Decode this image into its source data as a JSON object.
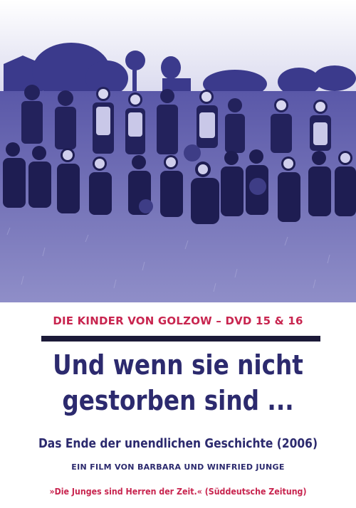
{
  "cover": {
    "series_line": "DIE KINDER VON GOLZOW – DVD 15 & 16",
    "title_line1": "Und wenn sie nicht",
    "title_line2": "gestorben sind ...",
    "subtitle": "Das Ende der unendlichen Geschichte (2006)",
    "credit": "EIN FILM VON BARBARA UND WINFRIED JUNGE",
    "quote": "»Die Junges sind Herren der Zeit.« (Süddeutsche Zeitung)"
  },
  "colors": {
    "photo_tint": "#3a3990",
    "title_blue": "#2c2a6e",
    "accent_red": "#c8254f",
    "rule_dark": "#1c1a38"
  }
}
